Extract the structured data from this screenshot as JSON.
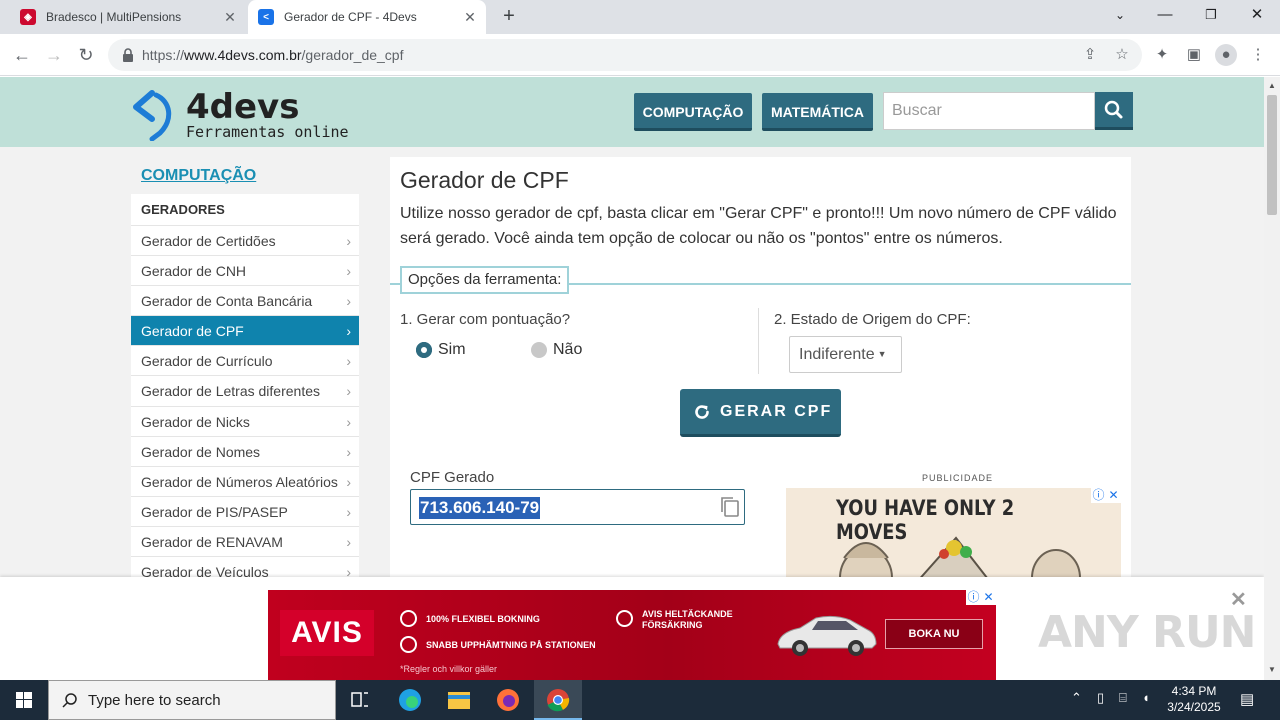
{
  "browser": {
    "tabs": [
      {
        "title": "Bradesco | MultiPensions",
        "active": false
      },
      {
        "title": "Gerador de CPF - 4Devs",
        "active": true
      }
    ],
    "url_prefix": "https://",
    "url_host": "www.4devs.com.br",
    "url_path": "/gerador_de_cpf"
  },
  "site": {
    "logo_name": "4devs",
    "logo_tagline": "Ferramentas online",
    "nav": [
      "COMPUTAÇÃO",
      "MATEMÁTICA"
    ],
    "search_placeholder": "Buscar"
  },
  "sidebar": {
    "category": "COMPUTAÇÃO",
    "section_title": "GERADORES",
    "items": [
      {
        "label": "Gerador de Certidões"
      },
      {
        "label": "Gerador de CNH"
      },
      {
        "label": "Gerador de Conta Bancária"
      },
      {
        "label": "Gerador de CPF",
        "active": true
      },
      {
        "label": "Gerador de Currículo"
      },
      {
        "label": "Gerador de Letras diferentes"
      },
      {
        "label": "Gerador de Nicks"
      },
      {
        "label": "Gerador de Nomes"
      },
      {
        "label": "Gerador de Números Aleatórios"
      },
      {
        "label": "Gerador de PIS/PASEP"
      },
      {
        "label": "Gerador de RENAVAM"
      },
      {
        "label": "Gerador de Veículos"
      }
    ],
    "chevron": "›"
  },
  "tool": {
    "title": "Gerador de CPF",
    "description": "Utilize nosso gerador de cpf, basta clicar em \"Gerar CPF\" e pronto!!! Um novo número de CPF válido será gerado. Você ainda tem opção de colocar ou não os \"pontos\" entre os números.",
    "options_label": "Opções da ferramenta:",
    "q1": "1. Gerar com pontuação?",
    "opt_yes": "Sim",
    "opt_no": "Não",
    "punctuation_selected": "Sim",
    "q2": "2. Estado de Origem do CPF:",
    "state_value": "Indiferente",
    "generate_button": "GERAR CPF",
    "result_label": "CPF Gerado",
    "result_value": "713.606.140-79"
  },
  "ads": {
    "publicity_label": "PUBLICIDADE",
    "game_headline": "YOU HAVE ONLY 2 MOVES",
    "avis": {
      "brand": "AVIS",
      "bullet1": "100% FLEXIBEL BOKNING",
      "bullet2": "SNABB UPPHÄMTNING PÅ STATIONEN",
      "bullet3_line1": "AVIS HELTÄCKANDE",
      "bullet3_line2": "FÖRSÄKRING",
      "note": "*Regler och villkor gäller",
      "cta": "BOKA NU"
    },
    "watermark": "ANY RUN"
  },
  "taskbar": {
    "search_placeholder": "Type here to search",
    "time": "4:34 PM",
    "date": "3/24/2025"
  }
}
